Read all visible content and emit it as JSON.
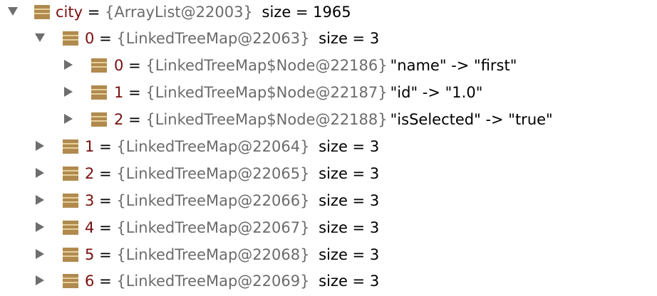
{
  "tree": {
    "root": {
      "name": "city",
      "eq": "=",
      "ref": "{ArrayList@22003}",
      "value": "size = 1965",
      "expanded": true
    },
    "item0": {
      "name": "0",
      "eq": "=",
      "ref": "{LinkedTreeMap@22063}",
      "value": "size = 3",
      "expanded": true,
      "children": [
        {
          "name": "0",
          "eq": "=",
          "ref": "{LinkedTreeMap$Node@22186}",
          "value": "\"name\" -> \"first\"",
          "expanded": false
        },
        {
          "name": "1",
          "eq": "=",
          "ref": "{LinkedTreeMap$Node@22187}",
          "value": "\"id\" -> \"1.0\"",
          "expanded": false
        },
        {
          "name": "2",
          "eq": "=",
          "ref": "{LinkedTreeMap$Node@22188}",
          "value": "\"isSelected\" -> \"true\"",
          "expanded": false
        }
      ]
    },
    "items": [
      {
        "name": "1",
        "eq": "=",
        "ref": "{LinkedTreeMap@22064}",
        "value": "size = 3",
        "expanded": false
      },
      {
        "name": "2",
        "eq": "=",
        "ref": "{LinkedTreeMap@22065}",
        "value": "size = 3",
        "expanded": false
      },
      {
        "name": "3",
        "eq": "=",
        "ref": "{LinkedTreeMap@22066}",
        "value": "size = 3",
        "expanded": false
      },
      {
        "name": "4",
        "eq": "=",
        "ref": "{LinkedTreeMap@22067}",
        "value": "size = 3",
        "expanded": false
      },
      {
        "name": "5",
        "eq": "=",
        "ref": "{LinkedTreeMap@22068}",
        "value": "size = 3",
        "expanded": false
      },
      {
        "name": "6",
        "eq": "=",
        "ref": "{LinkedTreeMap@22069}",
        "value": "size = 3",
        "expanded": false
      }
    ]
  },
  "icons": {
    "expanded": "triangle-down-icon",
    "collapsed": "triangle-right-icon",
    "field": "field-icon"
  },
  "colors": {
    "field_name": "#7a0f0f",
    "reference": "#6b6b6b",
    "value": "#000000",
    "arrow": "#6e6e6e",
    "icon_fill": "#b08a4e",
    "icon_stripe": "#e6cf9a"
  }
}
